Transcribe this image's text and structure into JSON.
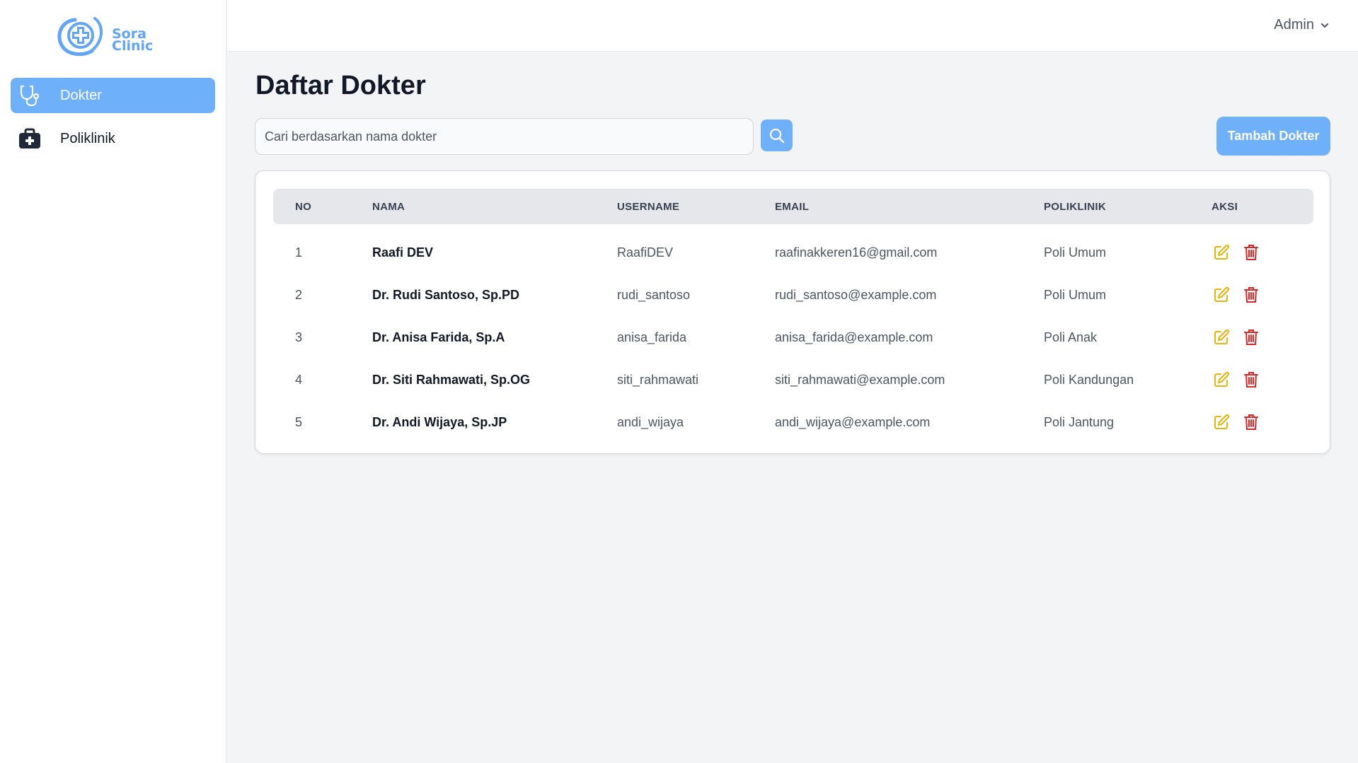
{
  "brand": {
    "line1": "Sora",
    "line2": "Clinic",
    "logo_icon": "cross-swoosh-logo",
    "color": "#60a5fa"
  },
  "sidebar": {
    "items": [
      {
        "label": "Dokter",
        "icon": "stethoscope-icon",
        "active": true
      },
      {
        "label": "Poliklinik",
        "icon": "medical-kit-icon",
        "active": false
      }
    ]
  },
  "header": {
    "user_label": "Admin"
  },
  "main": {
    "title": "Daftar Dokter",
    "search_placeholder": "Cari berdasarkan nama dokter",
    "add_button_label": "Tambah Dokter"
  },
  "table": {
    "columns": [
      "NO",
      "NAMA",
      "USERNAME",
      "EMAIL",
      "POLIKLINIK",
      "AKSI"
    ],
    "rows": [
      {
        "no": "1",
        "nama": "Raafi DEV",
        "username": "RaafiDEV",
        "email": "raafinakkeren16@gmail.com",
        "poliklinik": "Poli Umum"
      },
      {
        "no": "2",
        "nama": "Dr. Rudi Santoso, Sp.PD",
        "username": "rudi_santoso",
        "email": "rudi_santoso@example.com",
        "poliklinik": "Poli Umum"
      },
      {
        "no": "3",
        "nama": "Dr. Anisa Farida, Sp.A",
        "username": "anisa_farida",
        "email": "anisa_farida@example.com",
        "poliklinik": "Poli Anak"
      },
      {
        "no": "4",
        "nama": "Dr. Siti Rahmawati, Sp.OG",
        "username": "siti_rahmawati",
        "email": "siti_rahmawati@example.com",
        "poliklinik": "Poli Kandungan"
      },
      {
        "no": "5",
        "nama": "Dr. Andi Wijaya, Sp.JP",
        "username": "andi_wijaya",
        "email": "andi_wijaya@example.com",
        "poliklinik": "Poli Jantung"
      }
    ]
  },
  "colors": {
    "accent": "#6fb0fb",
    "edit": "#eab308",
    "delete": "#dc2626"
  }
}
